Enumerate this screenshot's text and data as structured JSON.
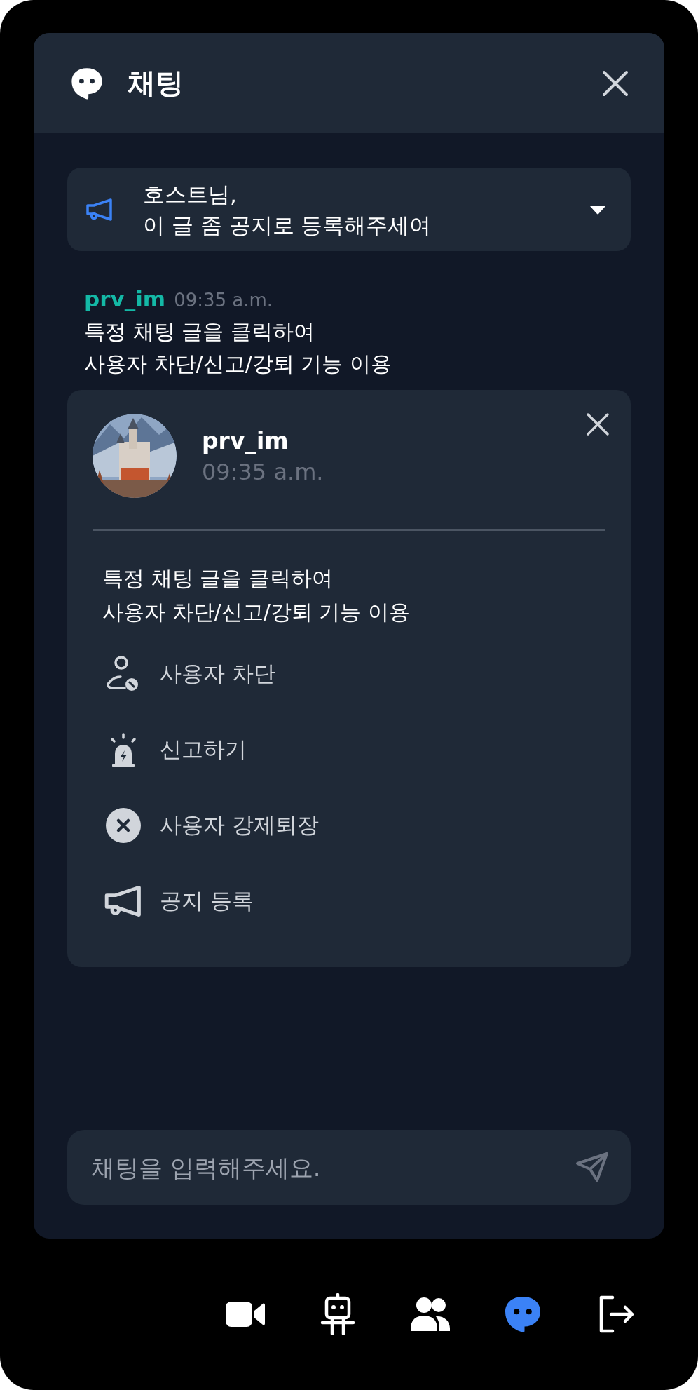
{
  "header": {
    "title": "채팅"
  },
  "notice": {
    "text": "호스트님,\n이 글 좀 공지로 등록해주세여"
  },
  "message": {
    "user": "prv_im",
    "time": "09:35 a.m.",
    "text": "특정 채팅 글을 클릭하여\n사용자 차단/신고/강퇴 기능 이용"
  },
  "popup": {
    "user": "prv_im",
    "time": "09:35 a.m.",
    "text": "특정 채팅 글을 클릭하여\n사용자 차단/신고/강퇴 기능 이용",
    "actions": [
      {
        "kind": "block",
        "label": "사용자 차단"
      },
      {
        "kind": "report",
        "label": "신고하기"
      },
      {
        "kind": "kick",
        "label": "사용자 강제퇴장"
      },
      {
        "kind": "notice",
        "label": "공지 등록"
      }
    ]
  },
  "input": {
    "placeholder": "채팅을 입력해주세요."
  },
  "nav": [
    {
      "kind": "video",
      "selected": false
    },
    {
      "kind": "robot",
      "selected": false
    },
    {
      "kind": "people",
      "selected": false
    },
    {
      "kind": "chat",
      "selected": true
    },
    {
      "kind": "exit",
      "selected": false
    }
  ]
}
